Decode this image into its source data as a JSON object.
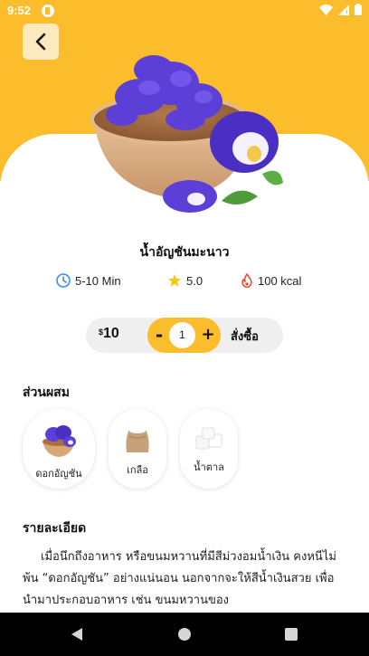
{
  "status_bar": {
    "time": "9:52"
  },
  "product": {
    "name": "น้ำอัญชันมะนาว",
    "time": "5-10 Min",
    "rating": "5.0",
    "calories": "100 kcal",
    "price_currency": "$",
    "price_value": "10",
    "quantity": "1",
    "minus_label": "-",
    "plus_label": "+",
    "buy_label": "สั่งซื้อ"
  },
  "ingredients": {
    "title": "ส่วนผสม",
    "items": [
      {
        "label": "ดอกอัญชัน",
        "icon": "butterfly-pea-icon"
      },
      {
        "label": "เกลือ",
        "icon": "salt-sack-icon"
      },
      {
        "label": "น้ำตาล",
        "icon": "sugar-cubes-icon"
      }
    ]
  },
  "details": {
    "title": "รายละเอียด",
    "text": "เมื่อนึกถึงอาหาร หรือขนมหวานที่มีสีม่วงอมน้ำเงิน คงหนีไม่พ้น “ดอกอัญชัน” อย่างแน่นอน นอกจากจะให้สีน้ำเงินสวย เพื่อนำมาประกอบอาหาร เช่น ขนมหวานของ"
  },
  "colors": {
    "accent": "#FBBD2B",
    "accent_light": "#FDE9BE",
    "flower": "#5B3FD6"
  }
}
